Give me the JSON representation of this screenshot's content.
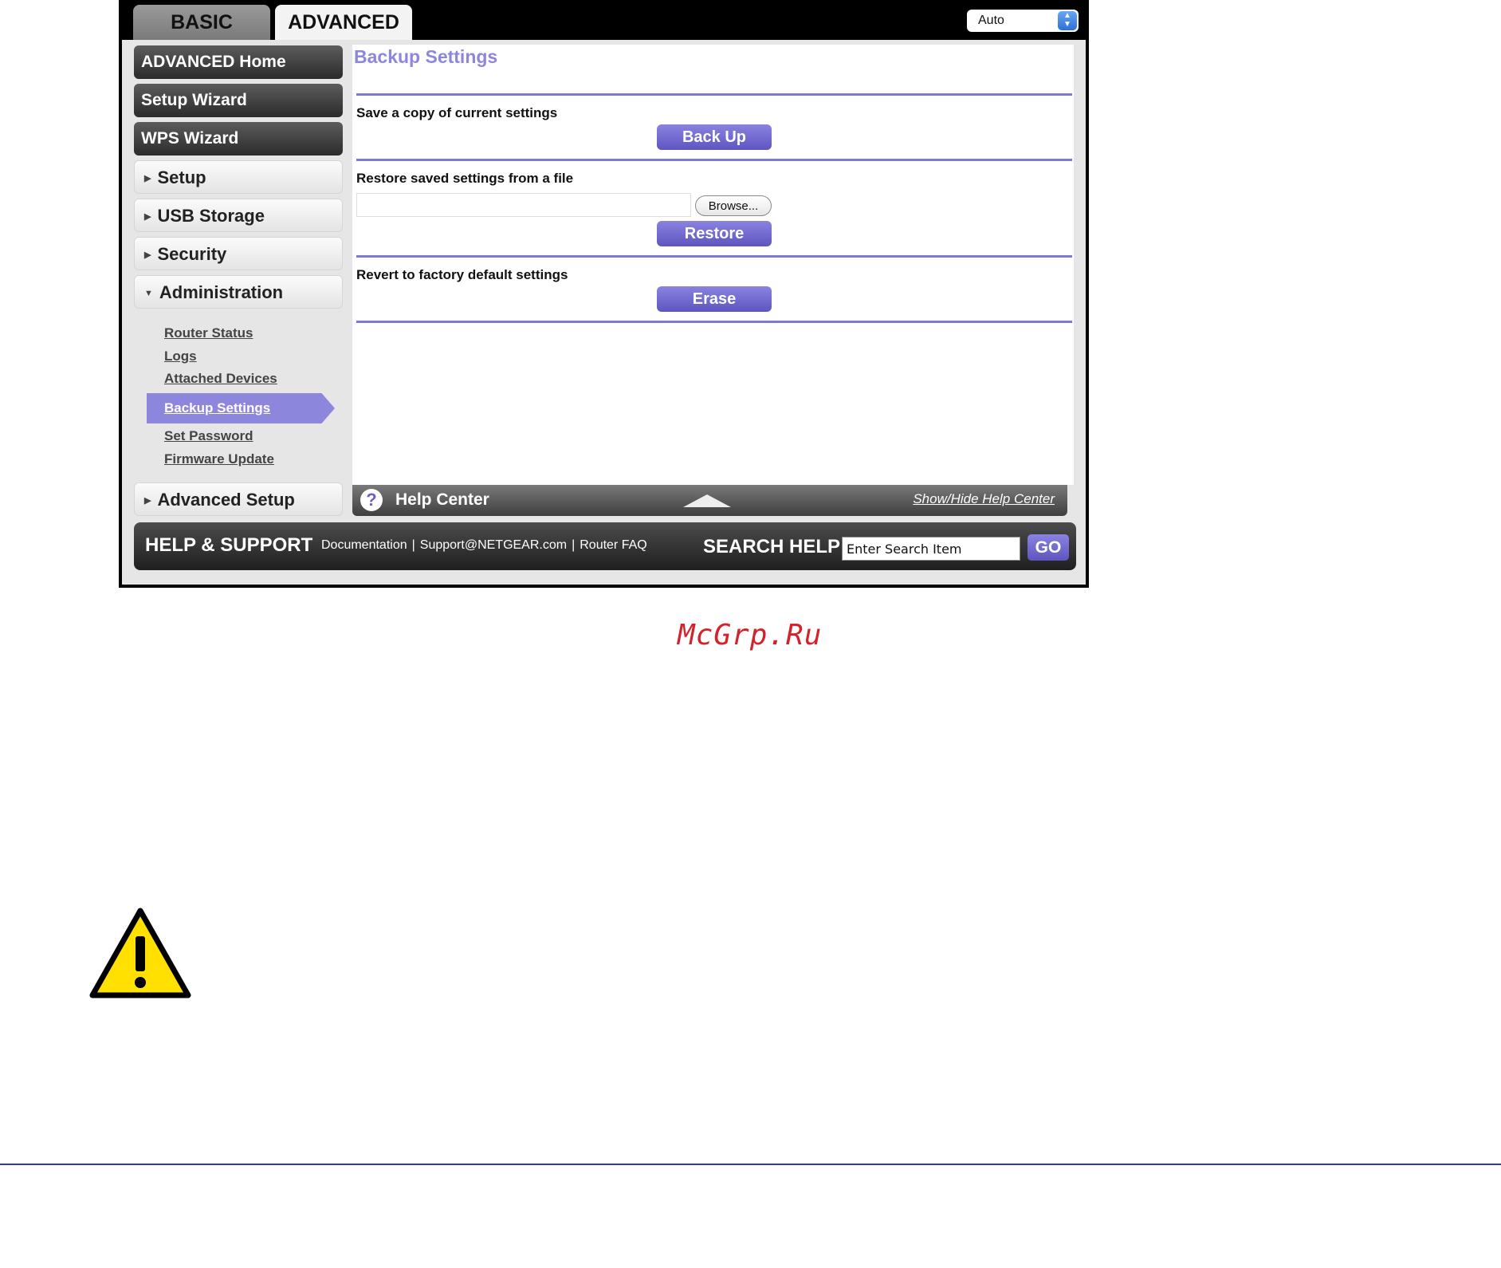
{
  "tabs": {
    "basic": "BASIC",
    "advanced": "ADVANCED"
  },
  "language": {
    "selected": "Auto"
  },
  "sidebar": {
    "advanced_home": "ADVANCED Home",
    "setup_wizard": "Setup Wizard",
    "wps_wizard": "WPS Wizard",
    "setup": "Setup",
    "usb_storage": "USB Storage",
    "security": "Security",
    "administration": "Administration",
    "admin_items": [
      "Router Status",
      "Logs",
      "Attached Devices",
      "Backup Settings",
      "Set Password",
      "Firmware Update"
    ],
    "advanced_setup": "Advanced Setup"
  },
  "main": {
    "title": "Backup Settings",
    "backup_label": "Save a copy of current settings",
    "backup_button": "Back Up",
    "restore_label": "Restore saved settings from a file",
    "browse_button": "Browse...",
    "file_value": "",
    "restore_button": "Restore",
    "erase_label": "Revert to factory default settings",
    "erase_button": "Erase"
  },
  "help_center": {
    "label": "Help Center",
    "toggle": "Show/Hide Help Center"
  },
  "footer": {
    "title": "HELP & SUPPORT",
    "links": [
      "Documentation",
      "Support@NETGEAR.com",
      "Router FAQ"
    ],
    "search_label": "SEARCH HELP",
    "search_value": "Enter Search Item",
    "go_button": "GO"
  },
  "watermark": "McGrp.Ru",
  "icons": {
    "help": "question-circle-icon",
    "warning": "warning-triangle-icon",
    "select_arrows": "updown-arrows-icon",
    "collapse": "triangle-up-icon"
  },
  "colors": {
    "accent": "#8d86dd",
    "warning": "#ffe000",
    "rule": "#2a3bb5",
    "watermark": "#d2232a"
  }
}
